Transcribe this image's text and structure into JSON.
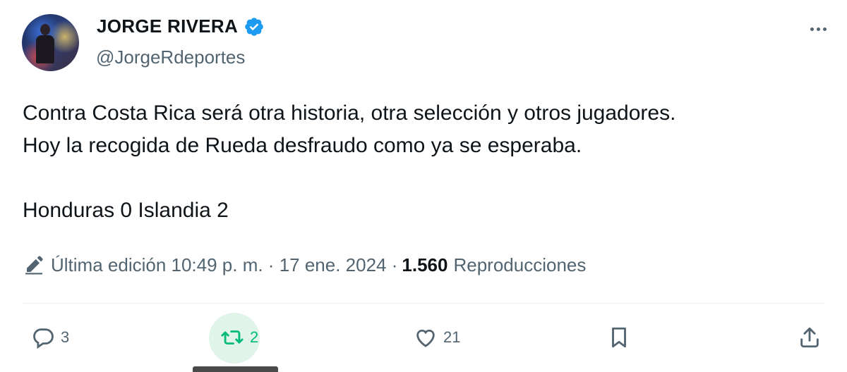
{
  "author": {
    "name": "JORGE RIVERA",
    "handle": "@JorgeRdeportes",
    "verified_color": "#1d9bf0"
  },
  "tweet": {
    "lines": [
      "Contra Costa Rica será otra historia, otra selección y otros jugadores.",
      "Hoy la recogida de Rueda desfraudo como ya se esperaba.",
      "Honduras 0 Islandia 2"
    ]
  },
  "meta": {
    "edited_label": "Última edición 10:49 p. m. · 17 ene. 2024 ·",
    "views_count": "1.560",
    "views_label": "Reproducciones"
  },
  "actions": {
    "replies": "3",
    "retweets": "2",
    "likes": "21"
  },
  "colors": {
    "text": "#0f1419",
    "secondary": "#536471",
    "retweet": "#00ba7c"
  }
}
